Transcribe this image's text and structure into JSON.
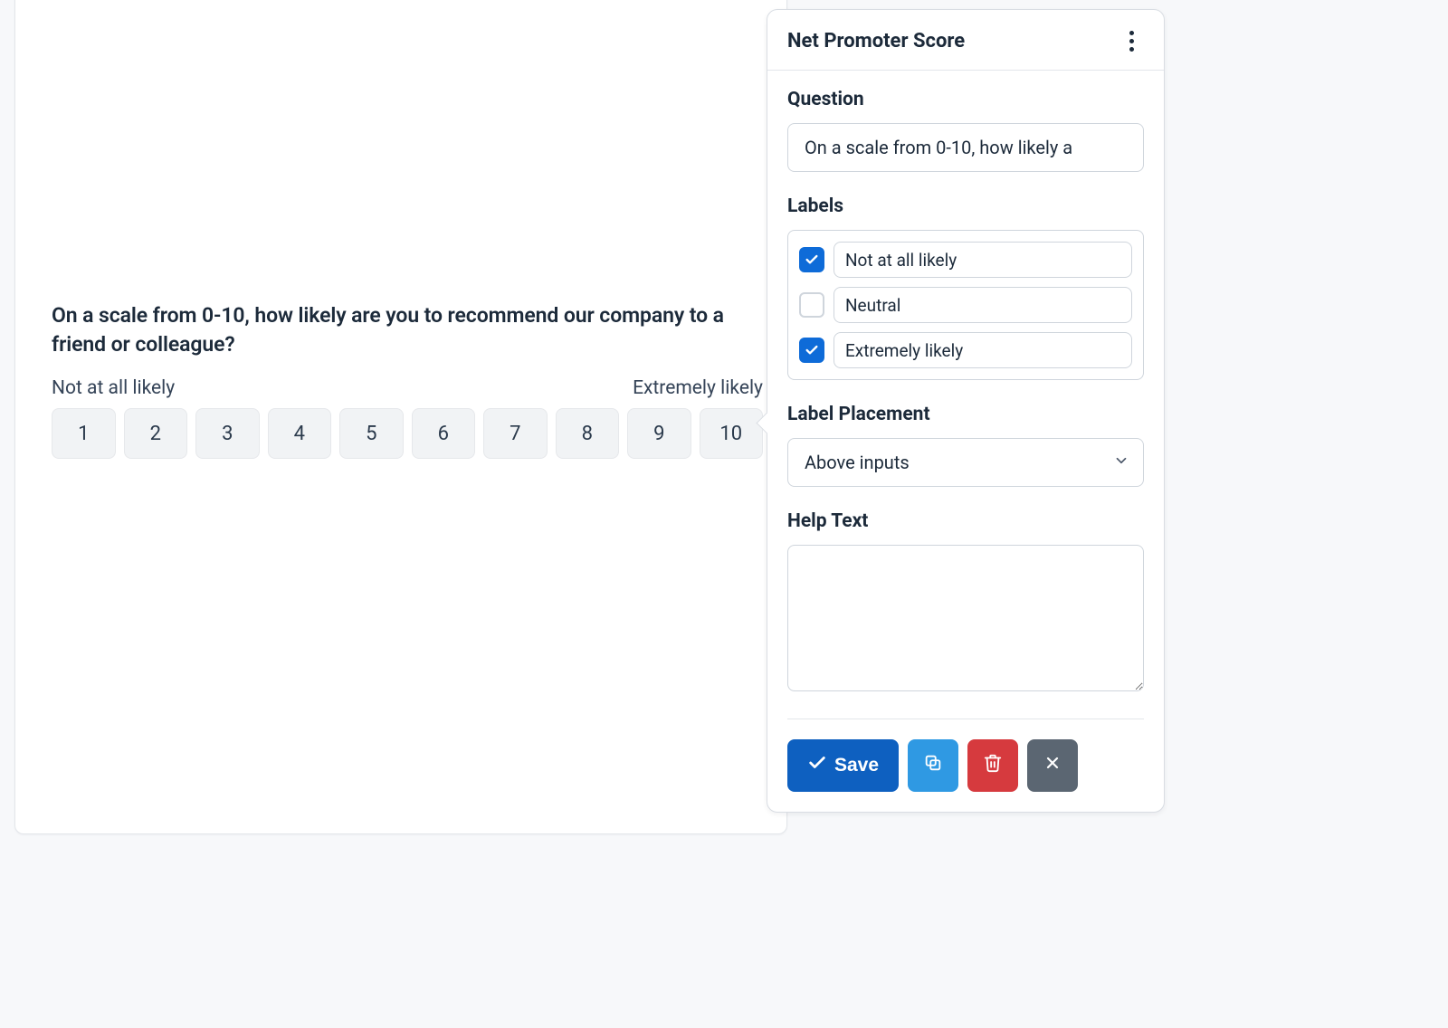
{
  "preview": {
    "question": "On a scale from 0-10, how likely are you to recommend our company to a friend or colleague?",
    "label_low": "Not at all likely",
    "label_high": "Extremely likely",
    "scale": [
      "1",
      "2",
      "3",
      "4",
      "5",
      "6",
      "7",
      "8",
      "9",
      "10"
    ]
  },
  "editor": {
    "title": "Net Promoter Score",
    "sections": {
      "question": "Question",
      "labels": "Labels",
      "label_placement": "Label Placement",
      "help_text": "Help Text"
    },
    "question_value": "On a scale from 0-10, how likely a",
    "labels": [
      {
        "checked": true,
        "value": "Not at all likely"
      },
      {
        "checked": false,
        "value": "Neutral"
      },
      {
        "checked": true,
        "value": "Extremely likely"
      }
    ],
    "label_placement_value": "Above inputs",
    "help_text_value": "",
    "footer": {
      "save": "Save"
    }
  },
  "colors": {
    "primary": "#0e6bd8",
    "danger": "#d63a3e",
    "info": "#2f99e3",
    "neutral": "#5b6672"
  }
}
